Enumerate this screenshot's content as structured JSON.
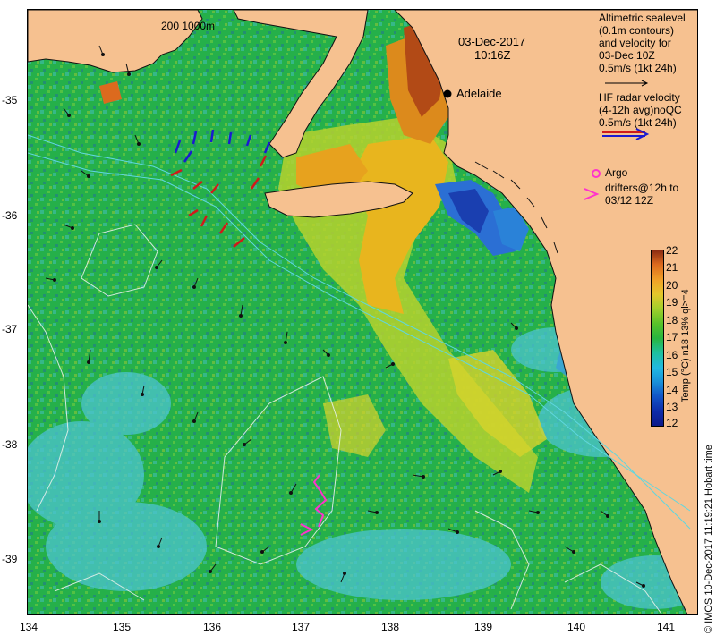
{
  "map": {
    "date": "03-Dec-2017",
    "time": "10:16Z",
    "scale_label": "200  1000m",
    "city": "Adelaide",
    "lat_ticks": [
      "-35",
      "-36",
      "-37",
      "-38",
      "-39"
    ],
    "lon_ticks": [
      "134",
      "135",
      "136",
      "137",
      "138",
      "139",
      "140",
      "141"
    ],
    "colors": {
      "land": "#f6c190",
      "sst_green": "#25b04a",
      "sst_light": "#49c1d2",
      "sst_warm": "#e7a21e"
    }
  },
  "legend": {
    "altimetric": [
      "Altimetric sealevel",
      "(0.1m contours)",
      "and velocity for",
      "03-Dec 10Z",
      "0.5m/s (1kt 24h)"
    ],
    "hf_radar": [
      "HF radar velocity",
      "(4-12h avg)noQC",
      "0.5m/s (1kt 24h)"
    ],
    "argo": "Argo",
    "drifters": [
      "drifters@12h to",
      "03/12 12Z"
    ]
  },
  "colorbar": {
    "label": "Temp (°C) n18 13% ql>=4",
    "ticks": [
      "22",
      "21",
      "20",
      "19",
      "18",
      "17",
      "16",
      "15",
      "14",
      "13",
      "12"
    ],
    "vmin": 12,
    "vmax": 22
  },
  "footer": "© IMOS 10-Dec-2017 11:19:21 Hobart time"
}
